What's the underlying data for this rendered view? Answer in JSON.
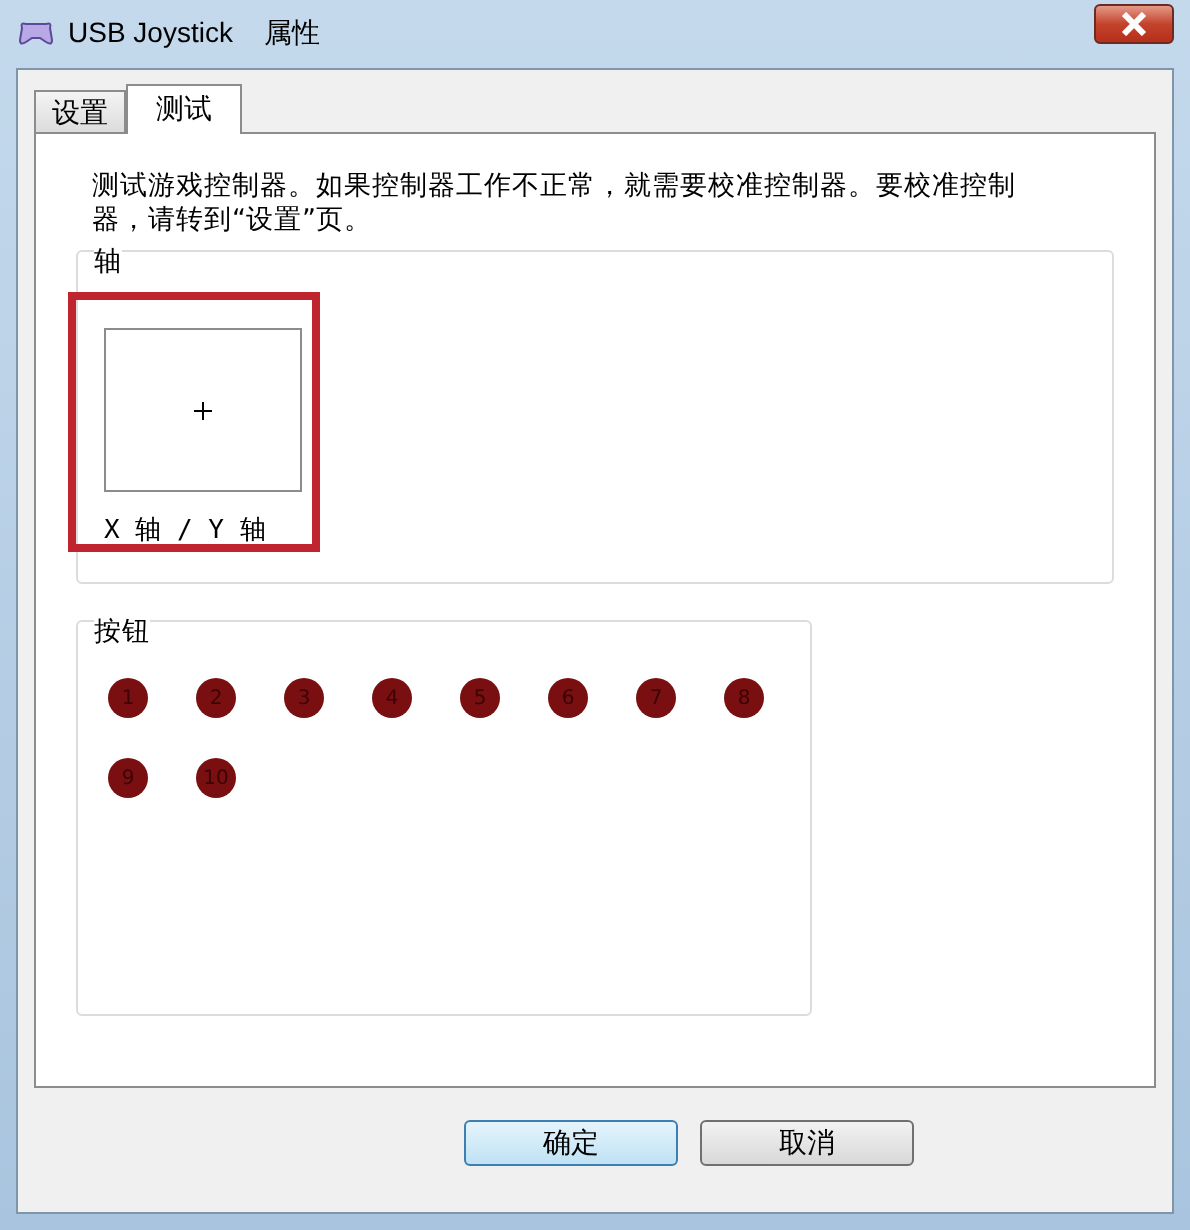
{
  "window": {
    "title": "USB Joystick    属性"
  },
  "tabs": [
    {
      "label": "设置",
      "selected": false
    },
    {
      "label": "测试",
      "selected": true
    }
  ],
  "description": "测试游戏控制器。如果控制器工作不正常，就需要校准控制器。要校准控制器，请转到“设置”页。",
  "axes": {
    "title": "轴",
    "label": "X 轴 / Y 轴",
    "highlighted": true
  },
  "buttons_group": {
    "title": "按钮",
    "buttons": [
      {
        "label": "1"
      },
      {
        "label": "2"
      },
      {
        "label": "3"
      },
      {
        "label": "4"
      },
      {
        "label": "5"
      },
      {
        "label": "6"
      },
      {
        "label": "7"
      },
      {
        "label": "8"
      },
      {
        "label": "9"
      },
      {
        "label": "10"
      }
    ]
  },
  "dialog_buttons": [
    {
      "label": "确定",
      "default": true
    },
    {
      "label": "取消",
      "default": false
    }
  ]
}
